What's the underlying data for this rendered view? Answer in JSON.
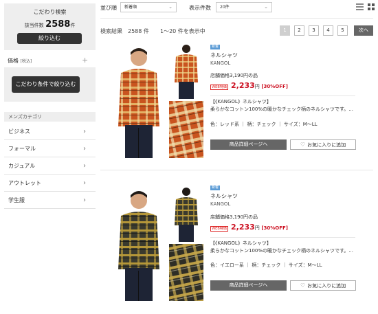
{
  "sidebar": {
    "filter_title": "こだわり検索",
    "count_label": "該当件数",
    "count_value": "2588",
    "count_unit": "件",
    "narrow_button": "絞り込む",
    "price_label": "価格",
    "price_sub": "[税込]",
    "condition_button": "こだわり条件で絞り込む",
    "category_heading": "メンズカテゴリ",
    "categories": [
      {
        "label": "ビジネス"
      },
      {
        "label": "フォーマル"
      },
      {
        "label": "カジュアル"
      },
      {
        "label": "アウトレット"
      },
      {
        "label": "学生服"
      }
    ]
  },
  "toolbar": {
    "sort_label": "並び順",
    "sort_value": "新着順",
    "display_label": "表示件数",
    "display_value": "20件"
  },
  "results": {
    "label": "検索結果",
    "count": "2588 件",
    "range": "1〜20 件を表示中"
  },
  "pagination": {
    "pages": [
      "1",
      "2",
      "3",
      "4",
      "5"
    ],
    "active": "1",
    "next": "次へ"
  },
  "products": [
    {
      "tag": "新着",
      "name": "ネルシャツ",
      "brand": "KANGOL",
      "store_price": "店舗価格3,190円の品",
      "web_tag": "WEB特価",
      "sale_price": "2,233",
      "yen": "円",
      "off": "[30%OFF]",
      "desc": "【《KANGOL》ネルシャツ】\n柔らかなコットン100%の暖かなチェック柄のネルシャツです。...",
      "spec_color": "色：レッド系",
      "spec_pattern": "柄：チェック",
      "spec_size": "サイズ：M〜LL",
      "detail_button": "商品詳細ページへ",
      "fav_button": "お気に入りに追加",
      "shirt_color": "#c9541f"
    },
    {
      "tag": "新着",
      "name": "ネルシャツ",
      "brand": "KANGOL",
      "store_price": "店舗価格3,190円の品",
      "web_tag": "WEB特価",
      "sale_price": "2,233",
      "yen": "円",
      "off": "[30%OFF]",
      "desc": "【《KANGOL》ネルシャツ】\n柔らかなコットン100%の暖かなチェック柄のネルシャツです。...",
      "spec_color": "色：イエロー系",
      "spec_pattern": "柄：チェック",
      "spec_size": "サイズ：M〜LL",
      "detail_button": "商品詳細ページへ",
      "fav_button": "お気に入りに追加",
      "shirt_color": "#3a3a2e"
    }
  ],
  "colors": {
    "accent_red": "#cc1122",
    "button_dark": "#333333",
    "new_tag": "#5b9bd5"
  }
}
